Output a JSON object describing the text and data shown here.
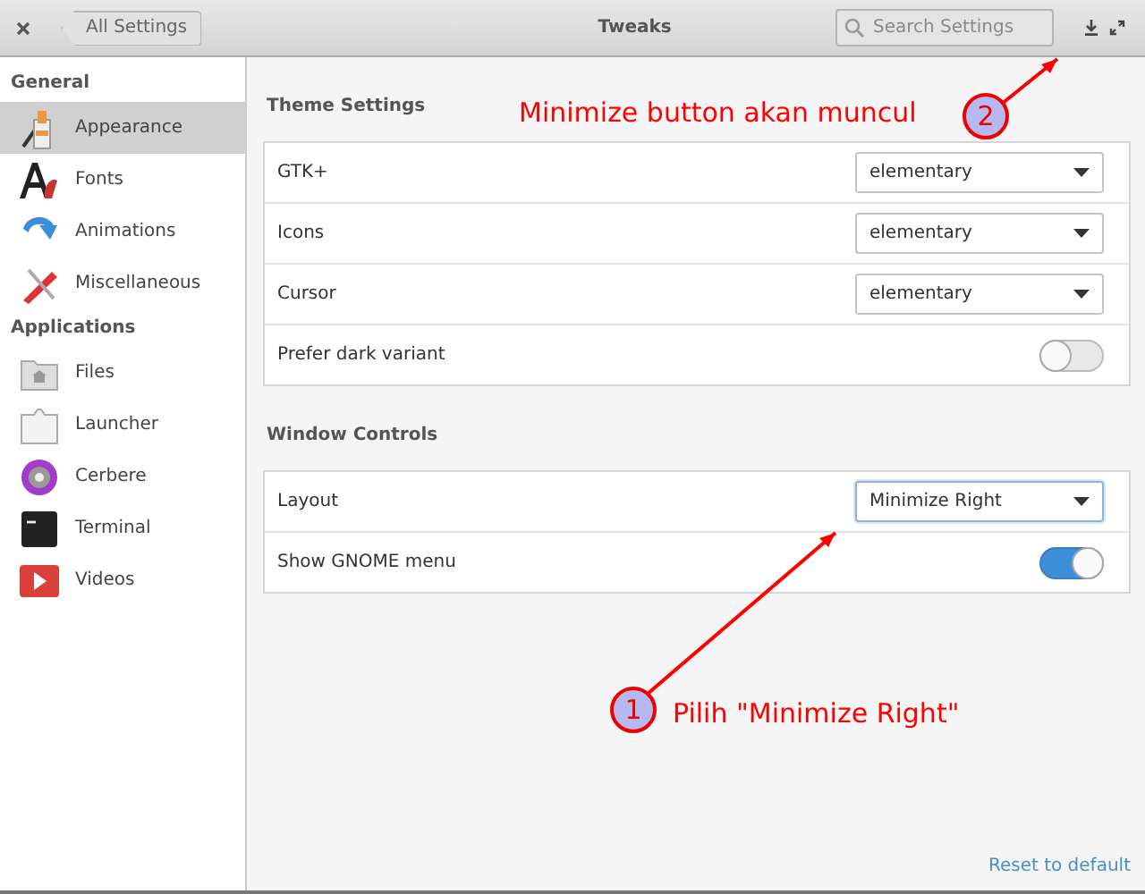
{
  "window": {
    "title": "Tweaks",
    "back_button": "All Settings",
    "search": {
      "placeholder": "Search Settings"
    }
  },
  "sidebar": {
    "sections": [
      {
        "title": "General",
        "items": [
          {
            "label": "Appearance",
            "selected": true
          },
          {
            "label": "Fonts",
            "selected": false
          },
          {
            "label": "Animations",
            "selected": false
          },
          {
            "label": "Miscellaneous",
            "selected": false
          }
        ]
      },
      {
        "title": "Applications",
        "items": [
          {
            "label": "Files",
            "selected": false
          },
          {
            "label": "Launcher",
            "selected": false
          },
          {
            "label": "Cerbere",
            "selected": false
          },
          {
            "label": "Terminal",
            "selected": false
          },
          {
            "label": "Videos",
            "selected": false
          }
        ]
      }
    ]
  },
  "sections": [
    {
      "title": "Theme Settings",
      "rows": [
        {
          "label": "GTK+",
          "kind": "dropdown",
          "value": "elementary",
          "focused": false
        },
        {
          "label": "Icons",
          "kind": "dropdown",
          "value": "elementary",
          "focused": false
        },
        {
          "label": "Cursor",
          "kind": "dropdown",
          "value": "elementary",
          "focused": false
        },
        {
          "label": "Prefer dark variant",
          "kind": "switch",
          "on": false
        }
      ]
    },
    {
      "title": "Window Controls",
      "rows": [
        {
          "label": "Layout",
          "kind": "dropdown",
          "value": "Minimize Right",
          "focused": true
        },
        {
          "label": "Show GNOME menu",
          "kind": "switch",
          "on": true
        }
      ]
    }
  ],
  "reset_link": "Reset to default",
  "annotations": [
    {
      "number": "2",
      "text": "Minimize button akan muncul"
    },
    {
      "number": "1",
      "text": "Pilih \"Minimize Right\""
    }
  ]
}
